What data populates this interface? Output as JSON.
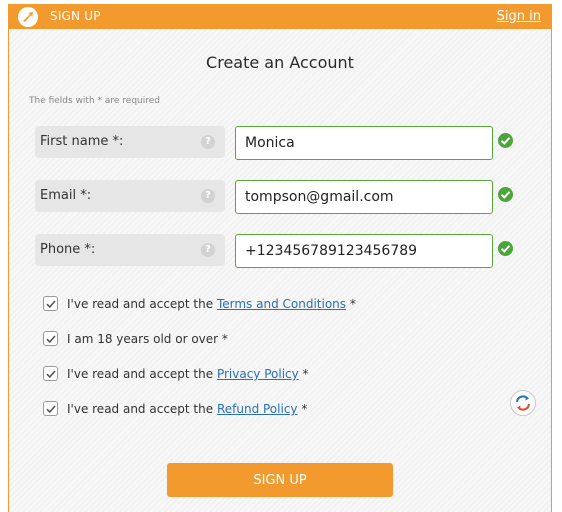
{
  "header": {
    "title": "SIGN UP",
    "signin_link": "Sign in",
    "accent_color": "#f39a2e"
  },
  "form": {
    "title": "Create an Account",
    "required_note": "The fields with * are required",
    "fields": [
      {
        "label": "First name *:",
        "value": "Monica",
        "icon": "help-icon",
        "status_icon": "checkmark-icon"
      },
      {
        "label": "Email *:",
        "value": "tompson@gmail.com",
        "icon": "help-icon",
        "status_icon": "checkmark-icon"
      },
      {
        "label": "Phone *:",
        "value": "+123456789123456789",
        "icon": "help-icon",
        "status_icon": "checkmark-icon"
      }
    ],
    "help_glyph": "?",
    "checkboxes": [
      {
        "prefix": "I've read and accept the ",
        "link": "Terms and Conditions",
        "suffix": " *",
        "checked": true
      },
      {
        "prefix": "I am 18 years old or over *",
        "link": "",
        "suffix": "",
        "checked": true
      },
      {
        "prefix": "I've read and accept the ",
        "link": "Privacy Policy",
        "suffix": " *",
        "checked": true
      },
      {
        "prefix": "I've read and accept the ",
        "link": "Refund Policy",
        "suffix": " *",
        "checked": true
      }
    ],
    "submit_label": "SIGN UP",
    "success_color": "#4aa63a",
    "link_color": "#2a6fb5"
  }
}
